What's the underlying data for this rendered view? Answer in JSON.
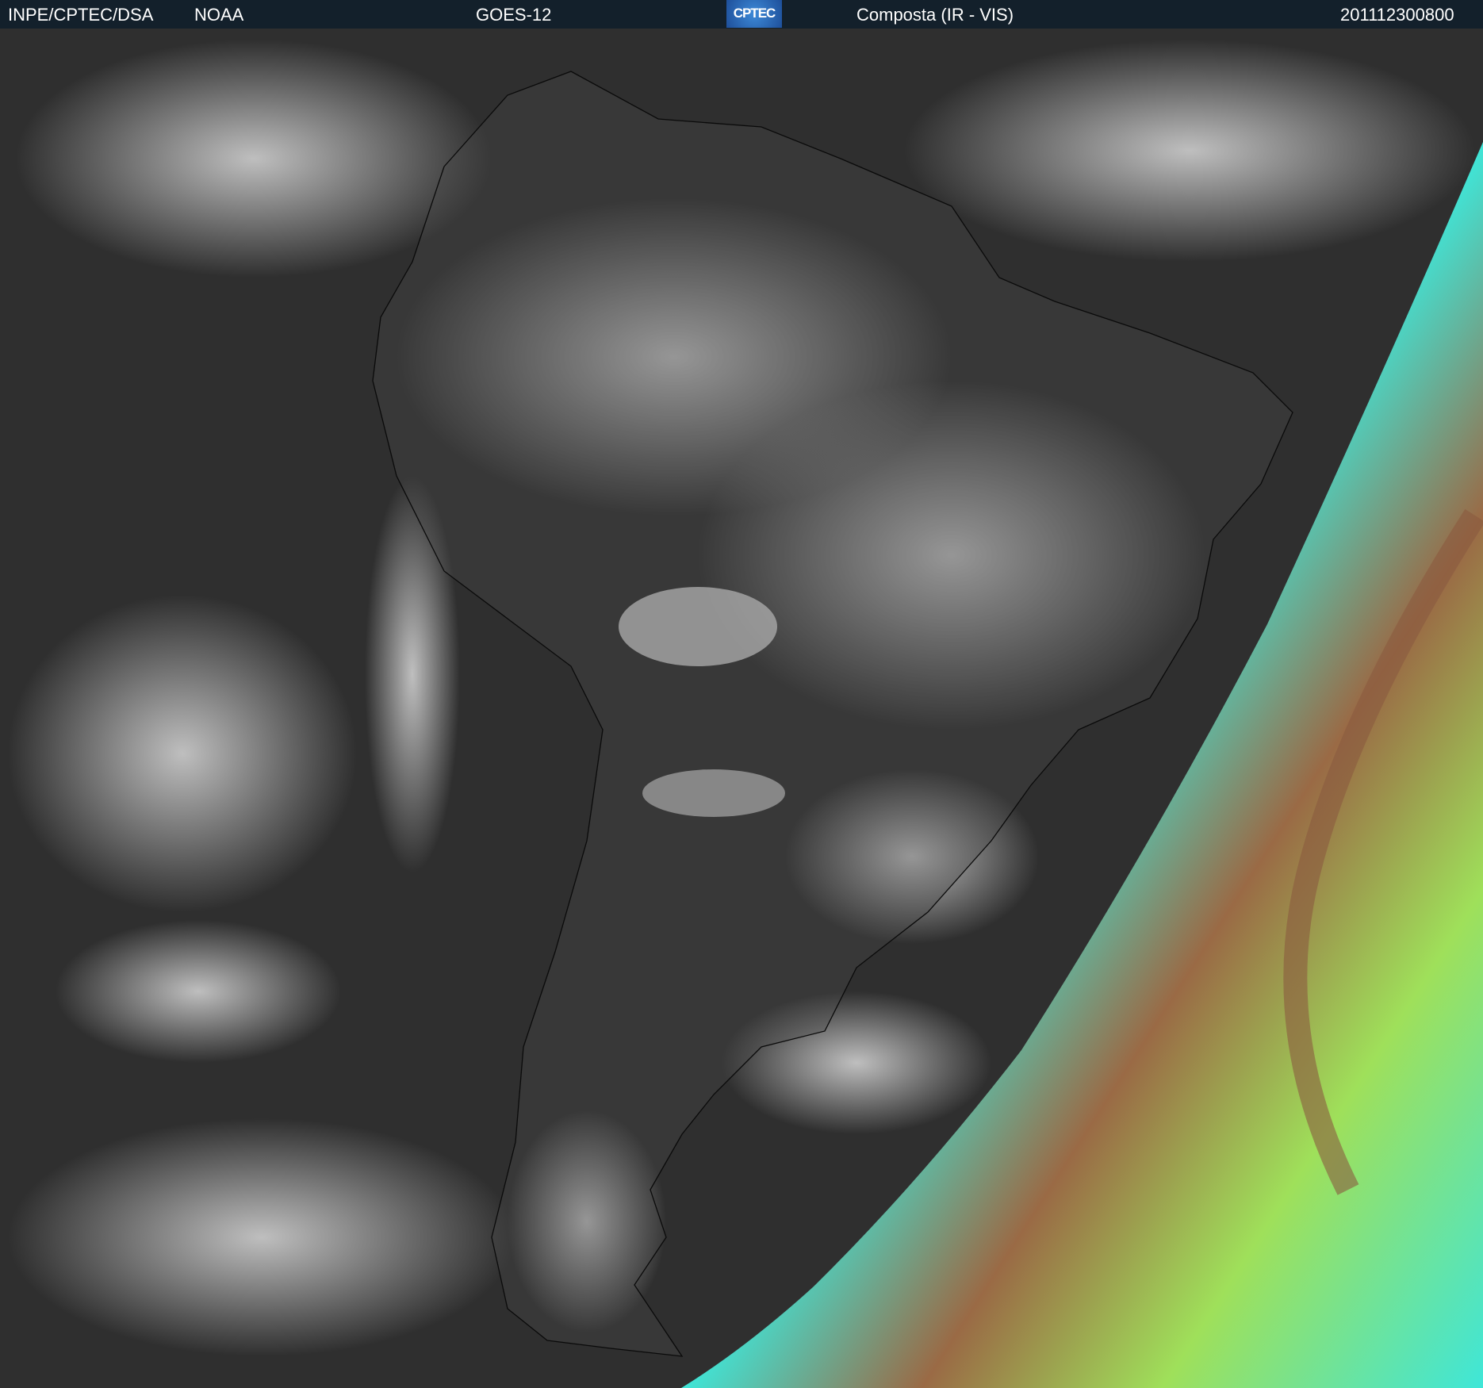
{
  "header": {
    "institution": "INPE/CPTEC/DSA",
    "agency": "NOAA",
    "satellite": "GOES-12",
    "logo_text": "CPTEC",
    "product": "Composta (IR - VIS)",
    "timestamp": "201112300800"
  },
  "colors": {
    "header_bg": "#13202b",
    "ocean_dark": "#2f2f2f",
    "cloud": "#d8d8d8",
    "vis_cyan": "#3fe6d8",
    "vis_green": "#9fe05a",
    "vis_brown": "#9a6a45"
  }
}
